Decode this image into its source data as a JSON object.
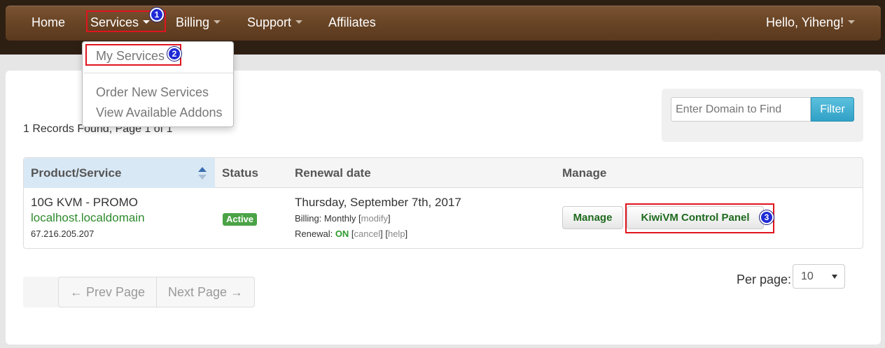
{
  "nav": {
    "home": "Home",
    "services": "Services",
    "billing": "Billing",
    "support": "Support",
    "affiliates": "Affiliates",
    "user": "Hello, Yiheng!"
  },
  "dropdown": {
    "my_services": "My Services",
    "order_new": "Order New Services",
    "view_addons": "View Available Addons"
  },
  "markers": [
    "1",
    "2",
    "3"
  ],
  "records_text": "1 Records Found, Page 1 of 1",
  "filter": {
    "placeholder": "Enter Domain to Find",
    "button": "Filter"
  },
  "table": {
    "headers": {
      "product": "Product/Service",
      "status": "Status",
      "renewal": "Renewal date",
      "manage": "Manage"
    },
    "rows": [
      {
        "product": "10G KVM - PROMO",
        "domain": "localhost.localdomain",
        "ip": "67.216.205.207",
        "status": "Active",
        "renewal_date": "Thursday, September 7th, 2017",
        "billing_label": "Billing: Monthly [",
        "billing_link": "modify",
        "billing_close": "]",
        "renewal_label": "Renewal: ",
        "renewal_state": "ON",
        "cancel_open": " [",
        "cancel_link": "cancel",
        "help_open": "] [",
        "help_link": "help",
        "help_close": "]",
        "manage_btn": "Manage",
        "panel_btn": "KiwiVM Control Panel"
      }
    ]
  },
  "pagination": {
    "prev": "← Prev Page",
    "next": "Next Page →"
  },
  "per_page": {
    "label": "Per page:",
    "value": "10"
  },
  "colors": {
    "nav_brown": "#6a4526",
    "highlight_red": "#e0141e",
    "marker_blue": "#1f2bd6",
    "active_green": "#4aa346",
    "link_green": "#2e8b2e",
    "filter_blue": "#31a1c6"
  }
}
